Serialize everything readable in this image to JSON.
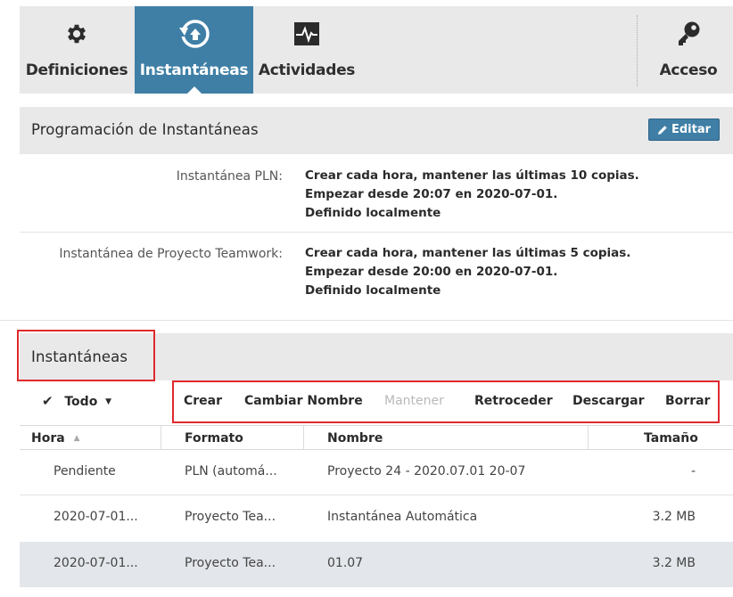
{
  "tabs": [
    {
      "label": "Definiciones",
      "icon": "gear-icon"
    },
    {
      "label": "Instantáneas",
      "icon": "snapshot-restore-icon",
      "active": true
    },
    {
      "label": "Actividades",
      "icon": "activity-monitor-icon"
    },
    {
      "label": "Acceso",
      "icon": "key-icon"
    }
  ],
  "schedule": {
    "title": "Programación de Instantáneas",
    "edit_label": "Editar",
    "items": [
      {
        "label": "Instantánea PLN:",
        "lines": [
          "Crear cada hora, mantener las últimas 10 copias.",
          "Empezar desde 20:07 en 2020-07-01.",
          "Definido localmente"
        ]
      },
      {
        "label": "Instantánea de Proyecto Teamwork:",
        "lines": [
          "Crear cada hora, mantener las últimas 5 copias.",
          "Empezar desde 20:00 en 2020-07-01.",
          "Definido localmente"
        ]
      }
    ]
  },
  "snapshots": {
    "title": "Instantáneas",
    "select_all": "Todo",
    "actions": [
      {
        "label": "Crear",
        "enabled": true
      },
      {
        "label": "Cambiar Nombre",
        "enabled": true
      },
      {
        "label": "Mantener",
        "enabled": false
      },
      {
        "label": "Retroceder",
        "enabled": true
      },
      {
        "label": "Descargar",
        "enabled": true
      },
      {
        "label": "Borrar",
        "enabled": true
      }
    ],
    "columns": [
      "Hora",
      "Formato",
      "Nombre",
      "Tamaño"
    ],
    "rows": [
      {
        "hora": "Pendiente",
        "formato": "PLN (automá...",
        "nombre": "Proyecto 24 - 2020.07.01 20-07",
        "tamano": "-",
        "selected": false
      },
      {
        "hora": "2020-07-01...",
        "formato": "Proyecto Tea...",
        "nombre": "Instantánea Automática",
        "tamano": "3.2 MB",
        "selected": false
      },
      {
        "hora": "2020-07-01...",
        "formato": "Proyecto Tea...",
        "nombre": "01.07",
        "tamano": "3.2 MB",
        "selected": true
      }
    ]
  },
  "colors": {
    "accent": "#3f7fa6",
    "header_bg": "#e9e9e9",
    "highlight_red": "#e0292e",
    "selected_row": "#e3e6ea"
  }
}
